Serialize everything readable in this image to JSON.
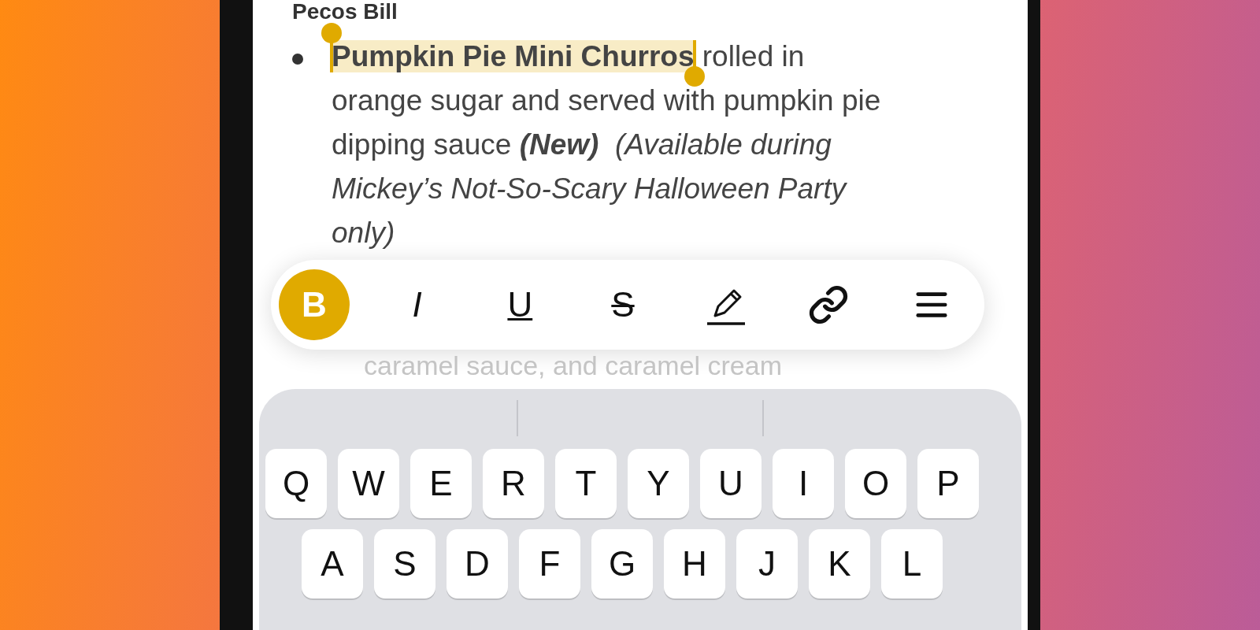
{
  "note": {
    "heading": "Pecos Bill",
    "item": [
      {
        "kind": "bold",
        "text": "Pumpkin Pie Mini Churros",
        "selected": true
      },
      {
        "kind": "plain",
        "text": " rolled in orange sugar and served with pumpkin pie dipping sauce ",
        "selected": false
      },
      {
        "kind": "bold_italic",
        "text": "(New)",
        "selected": false
      },
      {
        "kind": "italic",
        "text": "  (Available during Mickey’s Not-So-Scary Halloween Party only)",
        "selected": false
      }
    ],
    "faded_line": "caramel sauce, and caramel cream"
  },
  "format_toolbar": [
    {
      "kind": "bold",
      "label": "B",
      "selected": true
    },
    {
      "kind": "italic",
      "label": "I",
      "selected": false
    },
    {
      "kind": "underline",
      "label": "U",
      "selected": false
    },
    {
      "kind": "strikethrough",
      "label": "S",
      "selected": false
    },
    {
      "kind": "highlighter",
      "selected": false
    },
    {
      "kind": "link",
      "selected": false
    },
    {
      "kind": "alignment",
      "selected": false
    }
  ],
  "keyboard": {
    "rows": [
      [
        "Q",
        "W",
        "E",
        "R",
        "T",
        "Y",
        "U",
        "I",
        "O",
        "P"
      ],
      [
        "A",
        "S",
        "D",
        "F",
        "G",
        "H",
        "J",
        "K",
        "L"
      ]
    ]
  }
}
